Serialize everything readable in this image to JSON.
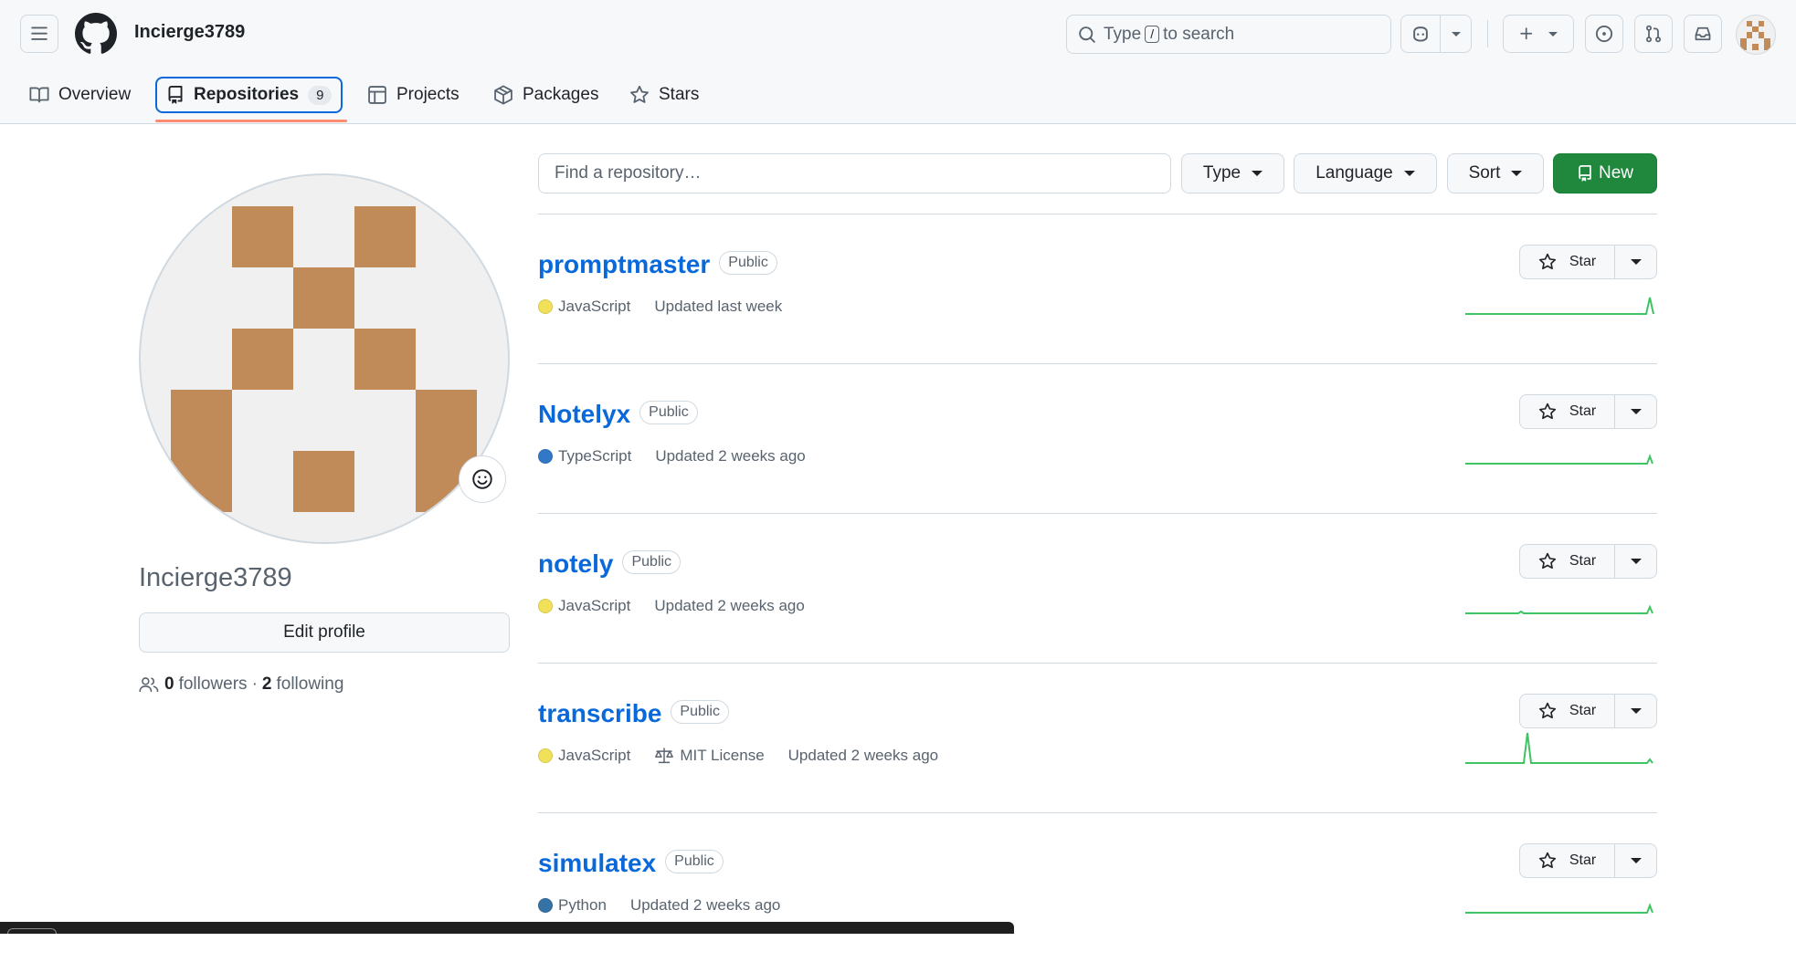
{
  "header": {
    "username": "Incierge3789",
    "search_prefix": "Type",
    "search_key": "/",
    "search_suffix": "to search"
  },
  "tabs": [
    {
      "label": "Overview",
      "icon": "book-icon"
    },
    {
      "label": "Repositories",
      "icon": "repo-icon",
      "count": "9"
    },
    {
      "label": "Projects",
      "icon": "table-icon"
    },
    {
      "label": "Packages",
      "icon": "package-icon"
    },
    {
      "label": "Stars",
      "icon": "star-icon"
    }
  ],
  "profile": {
    "name": "Incierge3789",
    "edit_label": "Edit profile",
    "followers_count": "0",
    "followers_label": "followers",
    "separator": "·",
    "following_count": "2",
    "following_label": "following"
  },
  "filters": {
    "search_placeholder": "Find a repository…",
    "type_label": "Type",
    "language_label": "Language",
    "sort_label": "Sort",
    "new_label": "New"
  },
  "repos": [
    {
      "name": "promptmaster",
      "visibility": "Public",
      "language": "JavaScript",
      "language_color": "#f1e05a",
      "license": "",
      "updated": "Updated last week",
      "star_label": "Star"
    },
    {
      "name": "Notelyx",
      "visibility": "Public",
      "language": "TypeScript",
      "language_color": "#3178c6",
      "license": "",
      "updated": "Updated 2 weeks ago",
      "star_label": "Star"
    },
    {
      "name": "notely",
      "visibility": "Public",
      "language": "JavaScript",
      "language_color": "#f1e05a",
      "license": "",
      "updated": "Updated 2 weeks ago",
      "star_label": "Star"
    },
    {
      "name": "transcribe",
      "visibility": "Public",
      "language": "JavaScript",
      "language_color": "#f1e05a",
      "license": "MIT License",
      "updated": "Updated 2 weeks ago",
      "star_label": "Star"
    },
    {
      "name": "simulatex",
      "visibility": "Public",
      "language": "Python",
      "language_color": "#3572A5",
      "license": "",
      "updated": "Updated 2 weeks ago",
      "star_label": "Star"
    }
  ],
  "colors": {
    "accent": "#0969da",
    "primary_button": "#1f883d",
    "tab_underline": "#fd8c73",
    "avatar_pixel": "#c18a59",
    "sparkline": "#40c463"
  }
}
